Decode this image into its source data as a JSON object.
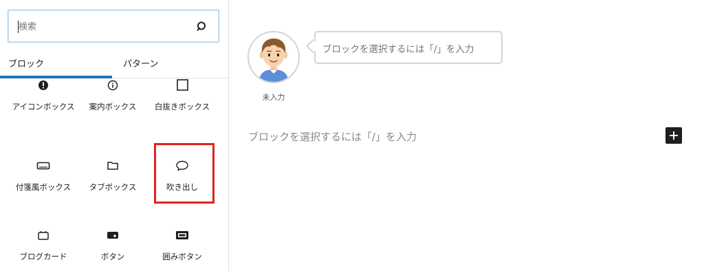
{
  "search": {
    "placeholder": "検索"
  },
  "tabs": [
    {
      "label": "ブロック",
      "active": true
    },
    {
      "label": "パターン",
      "active": false
    }
  ],
  "blocks": [
    {
      "label": "アイコンボックス",
      "icon": "alert-circle-icon"
    },
    {
      "label": "案内ボックス",
      "icon": "info-icon"
    },
    {
      "label": "白抜きボックス",
      "icon": "square-outline-icon"
    },
    {
      "label": "付箋風ボックス",
      "icon": "rectangle-outline-icon"
    },
    {
      "label": "タブボックス",
      "icon": "folder-icon"
    },
    {
      "label": "吹き出し",
      "icon": "speech-bubble-icon",
      "highlighted": true
    },
    {
      "label": "ブログカード",
      "icon": "card-icon"
    },
    {
      "label": "ボタン",
      "icon": "button-icon"
    },
    {
      "label": "囲みボタン",
      "icon": "framed-button-icon"
    }
  ],
  "editor": {
    "avatar_name": "未入力",
    "bubble_placeholder": "ブロックを選択するには「/」を入力",
    "paragraph_placeholder": "ブロックを選択するには「/」を入力"
  },
  "colors": {
    "accent": "#1e73be",
    "highlight": "#e02020",
    "dark": "#1e1e1e"
  }
}
